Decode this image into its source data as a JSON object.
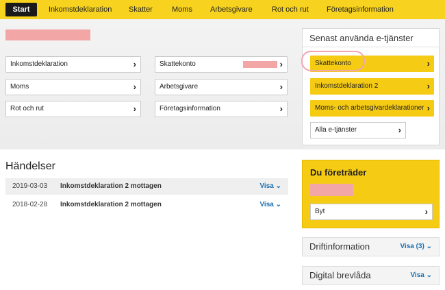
{
  "nav": {
    "start": "Start",
    "items": [
      "Inkomstdeklaration",
      "Skatter",
      "Moms",
      "Arbetsgivare",
      "Rot och rut",
      "Företagsinformation"
    ]
  },
  "shortcuts": {
    "inkomstdeklaration": "Inkomstdeklaration",
    "skattekonto": "Skattekonto",
    "moms": "Moms",
    "arbetsgivare": "Arbetsgivare",
    "rot_och_rut": "Rot och rut",
    "foretagsinformation": "Företagsinformation"
  },
  "recent": {
    "title": "Senast använda e-tjänster",
    "items": [
      "Skattekonto",
      "Inkomstdeklaration 2",
      "Moms- och arbetsgivardeklarationer"
    ],
    "all_label": "Alla e-tjänster"
  },
  "events": {
    "title": "Händelser",
    "rows": [
      {
        "date": "2019-03-03",
        "text": "Inkomstdeklaration 2 mottagen",
        "action": "Visa"
      },
      {
        "date": "2018-02-28",
        "text": "Inkomstdeklaration 2 mottagen",
        "action": "Visa"
      }
    ]
  },
  "representing": {
    "title": "Du företräder",
    "switch_label": "Byt"
  },
  "drift": {
    "title": "Driftinformation",
    "action": "Visa (3)"
  },
  "mailbox": {
    "title": "Digital brevlåda",
    "action": "Visa"
  },
  "colors": {
    "accent_yellow": "#f6cb14",
    "nav_yellow": "#f7d21e",
    "link_blue": "#1b6fb0",
    "highlight_pink": "#f2a5b3"
  }
}
